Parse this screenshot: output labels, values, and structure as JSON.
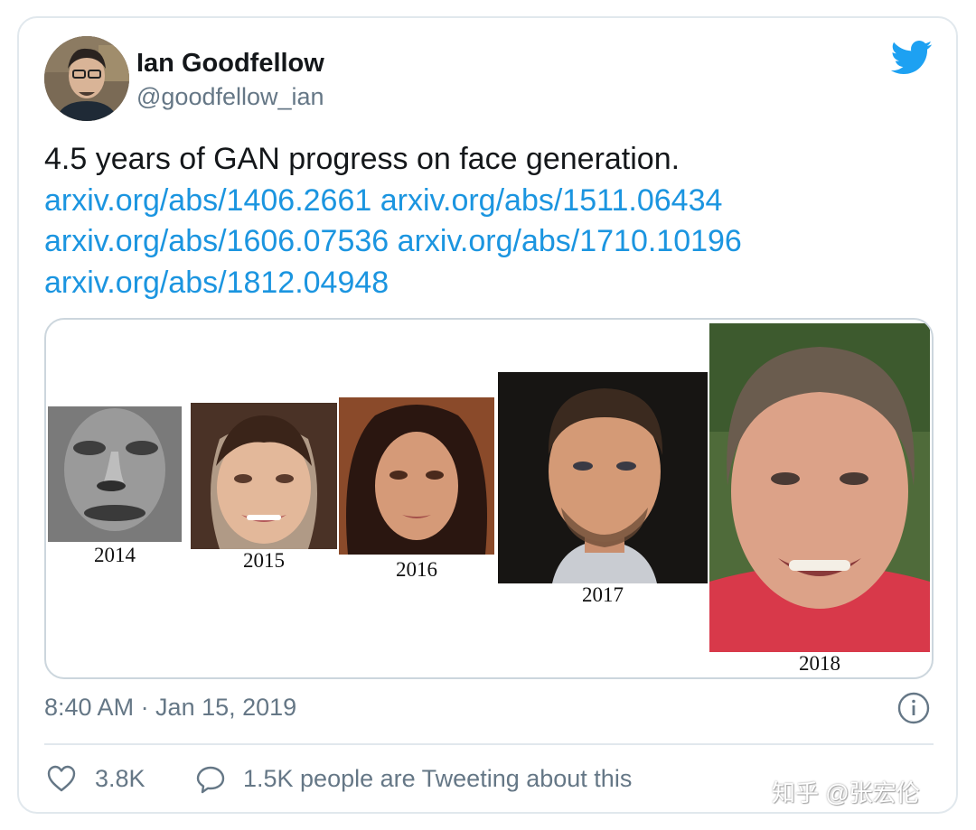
{
  "author": {
    "name": "Ian Goodfellow",
    "handle": "@goodfellow_ian"
  },
  "tweet": {
    "text": "4.5 years of GAN progress on face generation.",
    "links": [
      "arxiv.org/abs/1406.2661",
      "arxiv.org/abs/1511.06434",
      "arxiv.org/abs/1606.07536",
      "arxiv.org/abs/1710.10196",
      "arxiv.org/abs/1812.04948"
    ]
  },
  "media": {
    "years": [
      "2014",
      "2015",
      "2016",
      "2017",
      "2018"
    ]
  },
  "footer": {
    "timestamp": "8:40 AM · Jan 15, 2019",
    "likes": "3.8K",
    "tweeting": "1.5K people are Tweeting about this"
  },
  "watermark": "知乎 @张宏伦",
  "icons": [
    "twitter-bird-icon",
    "info-icon",
    "heart-icon",
    "reply-bubble-icon"
  ],
  "colors": {
    "link": "#1b95e0",
    "twitter_blue": "#1da1f2",
    "secondary_text": "#657786",
    "border": "#e1e8ed"
  }
}
